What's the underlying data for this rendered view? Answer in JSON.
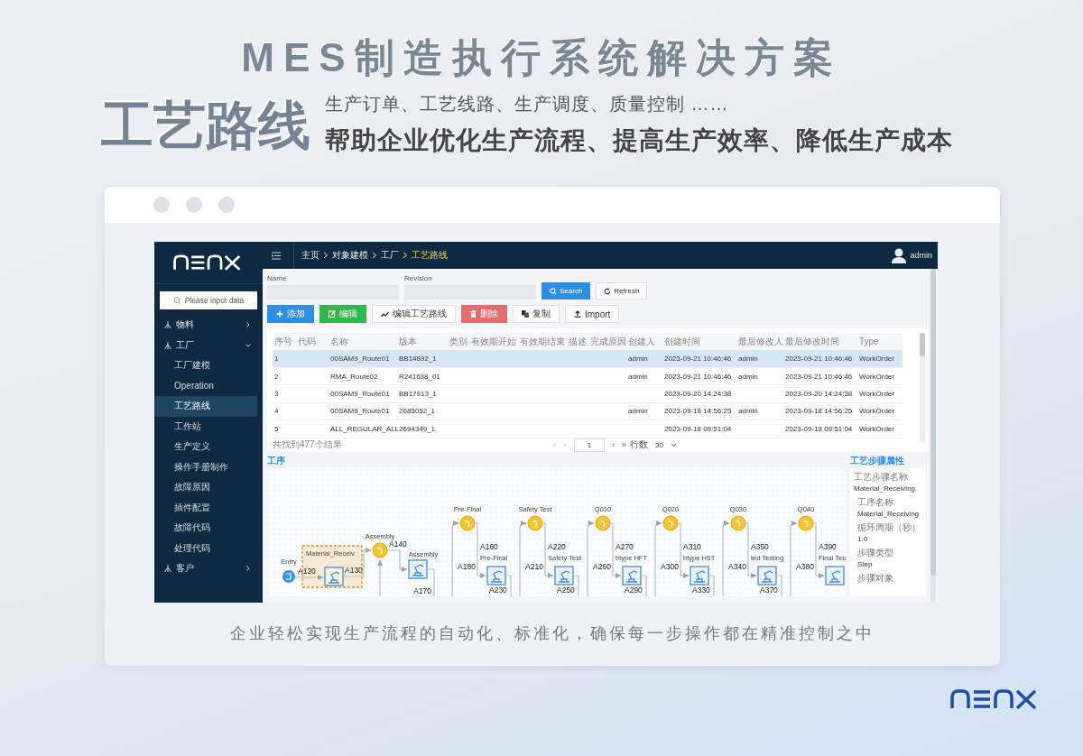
{
  "page": {
    "title": "MES制造执行系统解决方案",
    "feature": "工艺路线",
    "tagline": "生产订单、工艺线路、生产调度、质量控制 ……",
    "headline": "帮助企业优化生产流程、提高生产效率、降低生产成本",
    "caption": "企业轻松实现生产流程的自动化、标准化，确保每一步操作都在精准控制之中"
  },
  "app": {
    "breadcrumb": [
      {
        "label": "主页",
        "current": false
      },
      {
        "label": "对象建模",
        "current": false
      },
      {
        "label": "工厂",
        "current": false
      },
      {
        "label": "工艺路线",
        "current": true
      }
    ],
    "user": "admin",
    "sidebar": {
      "search_placeholder": "Please input data",
      "items": [
        {
          "label": "物料",
          "expanded": false
        },
        {
          "label": "工厂",
          "expanded": true,
          "children": [
            {
              "label": "工厂建模",
              "selected": false
            },
            {
              "label": "Operation",
              "selected": false
            },
            {
              "label": "工艺路线",
              "selected": true
            },
            {
              "label": "工作站",
              "selected": false
            },
            {
              "label": "生产定义",
              "selected": false
            },
            {
              "label": "操作手册制作",
              "selected": false
            },
            {
              "label": "故障原因",
              "selected": false
            },
            {
              "label": "插件配置",
              "selected": false
            },
            {
              "label": "故障代码",
              "selected": false
            },
            {
              "label": "处理代码",
              "selected": false
            }
          ]
        },
        {
          "label": "客户",
          "expanded": false
        }
      ]
    },
    "filters": [
      {
        "label": "Name"
      },
      {
        "label": "Revision"
      }
    ],
    "filter_buttons": [
      {
        "kind": "primary",
        "label": "Search"
      },
      {
        "kind": "default",
        "label": "Refresh"
      }
    ],
    "toolbar": [
      {
        "kind": "add",
        "label": "添加"
      },
      {
        "kind": "edit",
        "label": "编辑"
      },
      {
        "kind": "route",
        "label": "编辑工艺路线"
      },
      {
        "kind": "delete",
        "label": "删除"
      },
      {
        "kind": "copy",
        "label": "复制"
      },
      {
        "kind": "import",
        "label": "Import"
      }
    ],
    "table": {
      "columns": [
        "序号",
        "代码",
        "名称",
        "版本",
        "类别",
        "有效期开始",
        "有效期结束",
        "描述",
        "完成原因",
        "创建人",
        "创建时间",
        "最后修改人",
        "最后修改时间",
        "Type"
      ],
      "rows": [
        {
          "selected": true,
          "cells": [
            "1",
            null,
            "00SAM9_Route01",
            "BB14892_1",
            null,
            null,
            null,
            null,
            null,
            "admin",
            "2023-09-21 10:46:46",
            "admin",
            "2023-09-21 10:46:46",
            "WorkOrder"
          ]
        },
        {
          "selected": false,
          "cells": [
            "2",
            null,
            "RMA_Route02",
            "R241638_01",
            null,
            null,
            null,
            null,
            null,
            "admin",
            "2023-09-21 10:46:46",
            "admin",
            "2023-09-21 10:46:46",
            "WorkOrder"
          ]
        },
        {
          "selected": false,
          "cells": [
            "3",
            null,
            "00SAM9_Route01",
            "BB17913_1",
            null,
            null,
            null,
            null,
            null,
            null,
            "2023-09-20 14:24:38",
            null,
            "2023-09-20 14:24:38",
            "WorkOrder"
          ]
        },
        {
          "selected": false,
          "cells": [
            "4",
            null,
            "00SAM9_Route01",
            "2685052_1",
            null,
            null,
            null,
            null,
            null,
            "admin",
            "2023-09-18 14:56:25",
            "admin",
            "2023-09-18 14:56:25",
            "WorkOrder"
          ]
        },
        {
          "selected": false,
          "cells": [
            "5",
            null,
            "ALL_REGULAR_ALL",
            "2694349_1",
            null,
            null,
            null,
            null,
            null,
            null,
            "2023-09-18 09:51:04",
            null,
            "2023-09-18 09:51:04",
            "WorkOrder"
          ]
        }
      ]
    },
    "pagination": {
      "summary": "共找到477个结果",
      "before": [
        {
          "label": "«",
          "disabled": true
        },
        {
          "label": "‹",
          "disabled": true
        }
      ],
      "page": "1",
      "after": [
        {
          "label": "›",
          "disabled": false
        },
        {
          "label": "»",
          "disabled": false
        }
      ],
      "rows_label": "行数",
      "rows_per_page": "30"
    },
    "process": {
      "title": "工序",
      "stages": [
        {
          "kind": "entry",
          "start": "Entry",
          "step": "Material_Receiv",
          "selected": true,
          "edges": [
            "A120",
            "A130"
          ]
        },
        {
          "kind": "inline",
          "gate": "Assembly",
          "step": "Assembly",
          "edges": [
            "A140",
            "A170"
          ]
        },
        {
          "kind": "loop",
          "gate": "Pre-Final",
          "step": "Pre-Final",
          "edges": [
            "A160",
            "A180",
            "A230"
          ]
        },
        {
          "kind": "loop",
          "gate": "Safety Test",
          "step": "Safety Test",
          "edges": [
            "A220",
            "A210",
            "A250"
          ]
        },
        {
          "kind": "loop",
          "gate": "Q010",
          "step": "btype HFT",
          "edges": [
            "A270",
            "A260",
            "A290"
          ]
        },
        {
          "kind": "loop",
          "gate": "Q020",
          "step": "btype HST",
          "edges": [
            "A310",
            "A300",
            "A330"
          ]
        },
        {
          "kind": "loop",
          "gate": "Q030",
          "step": "ted Testing",
          "edges": [
            "A350",
            "A340",
            "A370"
          ]
        },
        {
          "kind": "loop",
          "gate": "Q040",
          "step": "Final Tes",
          "edges": [
            "A390",
            "A380"
          ]
        }
      ]
    },
    "properties": {
      "title": "工艺步骤属性",
      "fields": [
        {
          "label": "工艺步骤名称",
          "value": "Material_Receiving"
        },
        {
          "label": "工序名称",
          "value": "Material_Receiving"
        },
        {
          "label": "循环周期（秒）",
          "value": "1.0"
        },
        {
          "label": "步骤类型",
          "value": "Step"
        },
        {
          "label": "步骤对象"
        }
      ]
    }
  }
}
